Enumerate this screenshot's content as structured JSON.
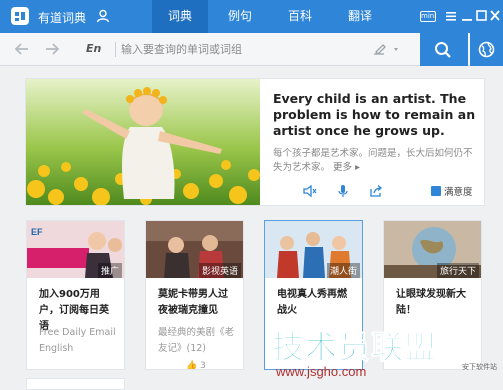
{
  "titlebar": {
    "app_title": "有道词典",
    "tabs": [
      {
        "label": "词典",
        "active": true
      },
      {
        "label": "例句",
        "active": false
      },
      {
        "label": "百科",
        "active": false
      },
      {
        "label": "翻译",
        "active": false
      }
    ],
    "mini_label": "mini",
    "accent_color": "#2f86d9"
  },
  "search": {
    "lang_label": "En",
    "placeholder": "输入要查询的单词或词组"
  },
  "hero": {
    "quote": "Every child is an artist. The problem is how to remain an artist once he grows up.",
    "translation": "每个孩子都是艺术家。问题是，长大后如何仍不失为艺术家。",
    "more_label": "更多",
    "satisfy_label": "满意度"
  },
  "cards": [
    {
      "tag": "推广",
      "title": "加入900万用户，订阅每日英语",
      "desc": "Free Daily Email English",
      "likes": ""
    },
    {
      "tag": "影视英语",
      "title": "莫妮卡带男人过夜被瑞克撞见",
      "desc": "最经典的美剧《老友记》(12)",
      "likes": "3"
    },
    {
      "tag": "潮人街",
      "title": "电视真人秀再燃战火",
      "desc": "",
      "likes": ""
    },
    {
      "tag": "旅行天下",
      "title": "让眼球发现新大陆！",
      "desc": "",
      "likes": ""
    }
  ],
  "watermark": {
    "main": "技术员联盟",
    "url": "www.jsgho.com",
    "small": "安下软件站"
  }
}
